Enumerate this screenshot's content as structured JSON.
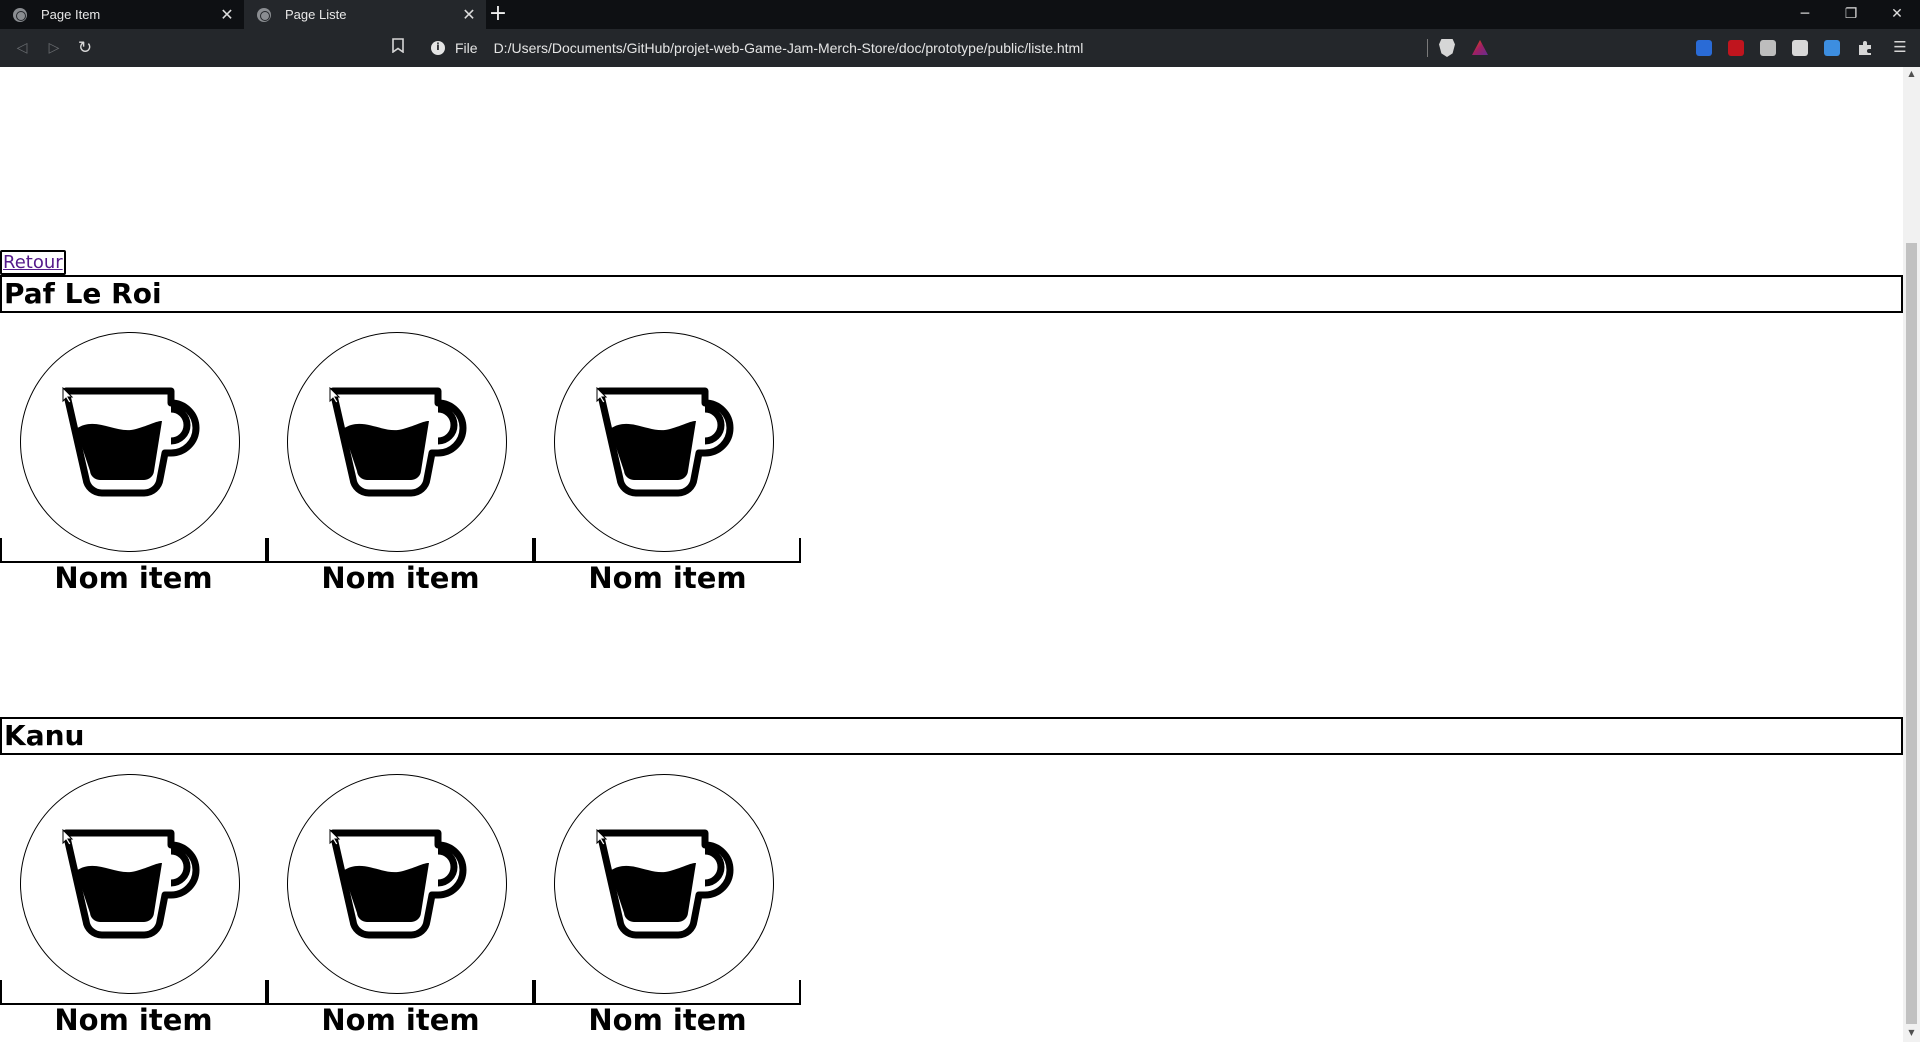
{
  "browser": {
    "tabs": [
      {
        "label": "Page Item",
        "active": false
      },
      {
        "label": "Page Liste",
        "active": true
      }
    ],
    "address": {
      "scheme": "File",
      "url": "D:/Users/Documents/GitHub/projet-web-Game-Jam-Merch-Store/doc/prototype/public/liste.html"
    }
  },
  "page": {
    "back_label": "Retour",
    "sections": [
      {
        "title": "Paf Le Roi",
        "items": [
          {
            "name": "Nom item",
            "icon": "coffee-cup-icon"
          },
          {
            "name": "Nom item",
            "icon": "coffee-cup-icon"
          },
          {
            "name": "Nom item",
            "icon": "coffee-cup-icon"
          }
        ]
      },
      {
        "title": "Kanu",
        "items": [
          {
            "name": "Nom item",
            "icon": "coffee-cup-icon"
          },
          {
            "name": "Nom item",
            "icon": "coffee-cup-icon"
          },
          {
            "name": "Nom item",
            "icon": "coffee-cup-icon"
          }
        ]
      }
    ]
  }
}
